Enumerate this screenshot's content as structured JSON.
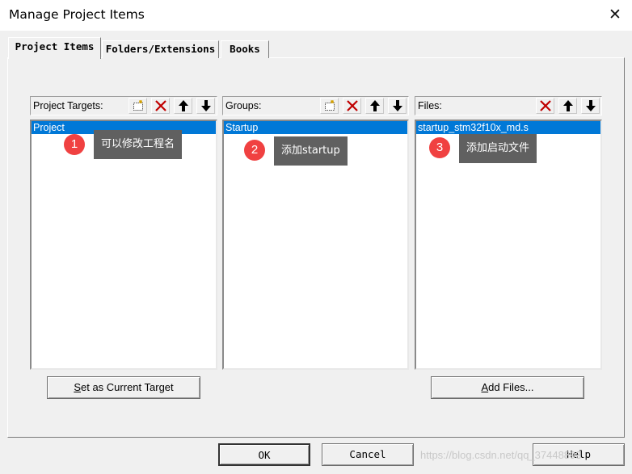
{
  "window": {
    "title": "Manage Project Items",
    "close_glyph": "✕"
  },
  "tabs": [
    {
      "label": "Project Items",
      "active": true
    },
    {
      "label": "Folders/Extensions",
      "active": false
    },
    {
      "label": "Books",
      "active": false
    }
  ],
  "panes": {
    "targets": {
      "label": "Project Targets:",
      "items": [
        "Project"
      ],
      "toolbar": [
        "new-icon",
        "delete-icon",
        "move-up-icon",
        "move-down-icon"
      ]
    },
    "groups": {
      "label": "Groups:",
      "items": [
        "Startup"
      ],
      "toolbar": [
        "new-icon",
        "delete-icon",
        "move-up-icon",
        "move-down-icon"
      ]
    },
    "files": {
      "label": "Files:",
      "items": [
        "startup_stm32f10x_md.s"
      ],
      "toolbar": [
        "delete-icon",
        "move-up-icon",
        "move-down-icon"
      ]
    }
  },
  "buttons": {
    "set_target": {
      "underline": "S",
      "rest": "et as Current Target"
    },
    "add_files": {
      "underline": "A",
      "rest": "dd Files..."
    },
    "ok": "OK",
    "cancel": "Cancel",
    "help": "Help"
  },
  "annotations": [
    {
      "num": "1",
      "text": "可以修改工程名"
    },
    {
      "num": "2",
      "text": "添加startup"
    },
    {
      "num": "3",
      "text": "添加启动文件"
    }
  ],
  "watermark": "https://blog.csdn.net/qq_37448893",
  "colors": {
    "selection": "#0078d7",
    "badge": "#f04141",
    "tooltip": "#606060",
    "delete_icon": "#c00000"
  }
}
